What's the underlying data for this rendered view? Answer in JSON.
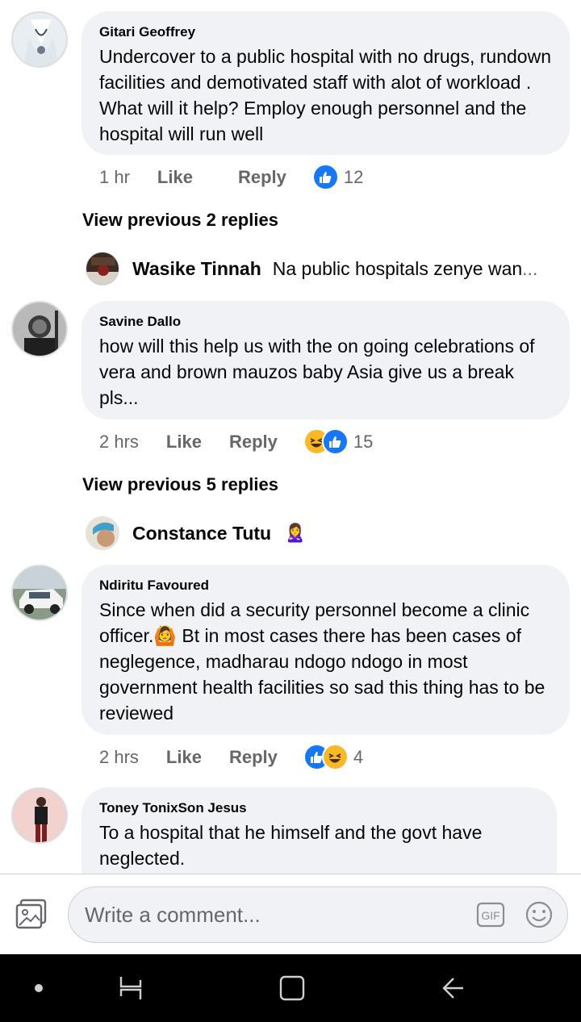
{
  "comments": [
    {
      "author": "Gitari Geoffrey",
      "text": "Undercover to a public hospital with no drugs, rundown facilities and demotivated staff with alot of workload . What will it help?  Employ enough personnel and the hospital will run well",
      "time": "1 hr",
      "like_label": "Like",
      "reply_label": "Reply",
      "reactions": [
        "like"
      ],
      "reaction_count": "12",
      "view_previous": "View previous 2 replies",
      "reply_preview": {
        "name": "Wasike Tinnah",
        "text": "Na public hospitals zenye wan",
        "ellipsis": "..."
      }
    },
    {
      "author": "Savine Dallo",
      "text": "how will this help us with the on going celebrations of vera and brown mauzos baby Asia give us a break pls...",
      "time": "2 hrs",
      "like_label": "Like",
      "reply_label": "Reply",
      "reactions": [
        "haha",
        "like"
      ],
      "reaction_count": "15",
      "view_previous": "View previous 5 replies",
      "reply_preview": {
        "name": "Constance Tutu",
        "text": "",
        "emoji": "🙎‍♀️"
      }
    },
    {
      "author": "Ndiritu Favoured",
      "text": "Since when did a security personnel become a clinic officer.🙆 Bt in most cases there has been cases of neglegence, madharau ndogo ndogo in most government health facilities so sad this thing has to be reviewed",
      "time": "2 hrs",
      "like_label": "Like",
      "reply_label": "Reply",
      "reactions": [
        "like",
        "haha"
      ],
      "reaction_count": "4"
    },
    {
      "author": "Toney TonixSon Jesus",
      "text": "To a hospital that he himself and the govt have neglected."
    }
  ],
  "composer": {
    "placeholder": "Write a comment...",
    "gif_label": "GIF",
    "icons": [
      "photo-icon",
      "gif-icon",
      "emoji-icon"
    ]
  },
  "navbar": {
    "icons": [
      "dot-icon",
      "recent-apps-icon",
      "home-icon",
      "back-icon"
    ]
  },
  "colors": {
    "bubble": "#f0f2f5",
    "secondary_text": "#65676b",
    "like_blue": "#1877f2",
    "haha_yellow": "#f7b928"
  }
}
